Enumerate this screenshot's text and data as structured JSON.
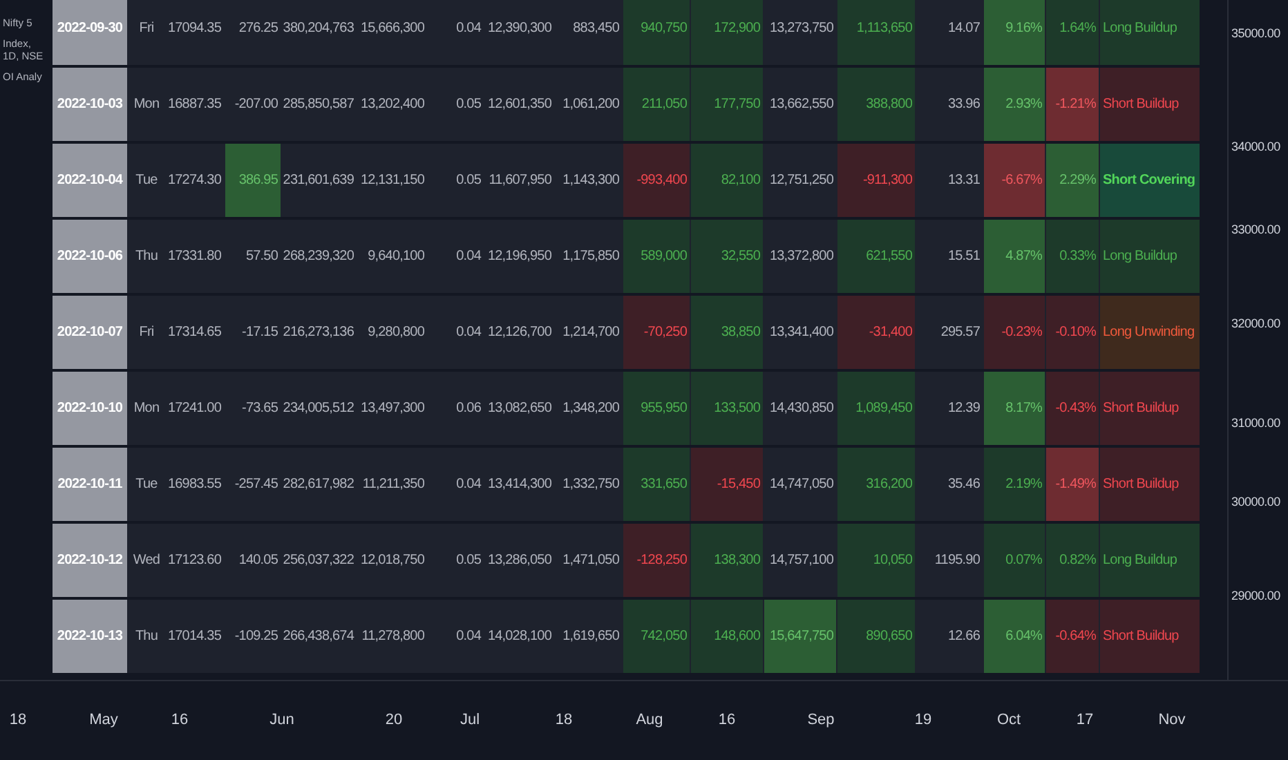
{
  "legend": [
    {
      "text": "Nifty 5"
    },
    {
      "text": "Index, 1D, NSE"
    },
    {
      "text": "OI Analy"
    }
  ],
  "table": {
    "rows": [
      {
        "date": "2022-09-30",
        "cells": [
          {
            "text": "Fri"
          },
          {
            "text": "17094.35"
          },
          {
            "text": "276.25"
          },
          {
            "text": "380,204,763"
          },
          {
            "text": "15,666,300"
          },
          {
            "text": "0.04"
          },
          {
            "text": "12,390,300"
          },
          {
            "text": "883,450"
          },
          {
            "text": "940,750",
            "color": "#1d3a2a"
          },
          {
            "text": "172,900",
            "color": "#1d3a2a"
          },
          {
            "text": "13,273,750"
          },
          {
            "text": "1,113,650",
            "color": "#1d3a2a"
          },
          {
            "text": "14.07"
          },
          {
            "text": "9.16%",
            "color": "#2c5e34"
          },
          {
            "text": "1.64%",
            "color": "#1d3a2a"
          },
          {
            "text": "Long Buildup",
            "color": "#1d3a2a"
          }
        ]
      },
      {
        "date": "2022-10-03",
        "cells": [
          {
            "text": "Mon"
          },
          {
            "text": "16887.35"
          },
          {
            "text": "-207.00"
          },
          {
            "text": "285,850,587"
          },
          {
            "text": "13,202,400"
          },
          {
            "text": "0.05"
          },
          {
            "text": "12,601,350"
          },
          {
            "text": "1,061,200"
          },
          {
            "text": "211,050",
            "color": "#1d3a2a"
          },
          {
            "text": "177,750",
            "color": "#1d3a2a"
          },
          {
            "text": "13,662,550"
          },
          {
            "text": "388,800",
            "color": "#1d3a2a"
          },
          {
            "text": "33.96"
          },
          {
            "text": "2.93%",
            "color": "#2c5e34"
          },
          {
            "text": "-1.21%",
            "color": "#6e2c31"
          },
          {
            "text": "Short Buildup",
            "color": "#3e1f26"
          }
        ]
      },
      {
        "date": "2022-10-04",
        "cells": [
          {
            "text": "Tue"
          },
          {
            "text": "17274.30"
          },
          {
            "text": "386.95",
            "color": "#2c5e34"
          },
          {
            "text": "231,601,639"
          },
          {
            "text": "12,131,150"
          },
          {
            "text": "0.05"
          },
          {
            "text": "11,607,950"
          },
          {
            "text": "1,143,300"
          },
          {
            "text": "-993,400",
            "color": "#3e1f26"
          },
          {
            "text": "82,100",
            "color": "#1d3a2a"
          },
          {
            "text": "12,751,250"
          },
          {
            "text": "-911,300",
            "color": "#3e1f26"
          },
          {
            "text": "13.31"
          },
          {
            "text": "-6.67%",
            "color": "#6e2c31"
          },
          {
            "text": "2.29%",
            "color": "#2c5e34"
          },
          {
            "text": "Short Covering",
            "color": "#184a3a"
          }
        ]
      },
      {
        "date": "2022-10-06",
        "cells": [
          {
            "text": "Thu"
          },
          {
            "text": "17331.80"
          },
          {
            "text": "57.50"
          },
          {
            "text": "268,239,320"
          },
          {
            "text": "9,640,100"
          },
          {
            "text": "0.04"
          },
          {
            "text": "12,196,950"
          },
          {
            "text": "1,175,850"
          },
          {
            "text": "589,000",
            "color": "#1d3a2a"
          },
          {
            "text": "32,550",
            "color": "#1d3a2a"
          },
          {
            "text": "13,372,800"
          },
          {
            "text": "621,550",
            "color": "#1d3a2a"
          },
          {
            "text": "15.51"
          },
          {
            "text": "4.87%",
            "color": "#2c5e34"
          },
          {
            "text": "0.33%",
            "color": "#1d3a2a"
          },
          {
            "text": "Long Buildup",
            "color": "#1d3a2a"
          }
        ]
      },
      {
        "date": "2022-10-07",
        "cells": [
          {
            "text": "Fri"
          },
          {
            "text": "17314.65"
          },
          {
            "text": "-17.15"
          },
          {
            "text": "216,273,136"
          },
          {
            "text": "9,280,800"
          },
          {
            "text": "0.04"
          },
          {
            "text": "12,126,700"
          },
          {
            "text": "1,214,700"
          },
          {
            "text": "-70,250",
            "color": "#3e1f26"
          },
          {
            "text": "38,850",
            "color": "#1d3a2a"
          },
          {
            "text": "13,341,400"
          },
          {
            "text": "-31,400",
            "color": "#3e1f26"
          },
          {
            "text": "295.57"
          },
          {
            "text": "-0.23%",
            "color": "#3e1f26"
          },
          {
            "text": "-0.10%",
            "color": "#3e1f26"
          },
          {
            "text": "Long Unwinding",
            "color": "#3f2a1d"
          }
        ]
      },
      {
        "date": "2022-10-10",
        "cells": [
          {
            "text": "Mon"
          },
          {
            "text": "17241.00"
          },
          {
            "text": "-73.65"
          },
          {
            "text": "234,005,512"
          },
          {
            "text": "13,497,300"
          },
          {
            "text": "0.06"
          },
          {
            "text": "13,082,650"
          },
          {
            "text": "1,348,200"
          },
          {
            "text": "955,950",
            "color": "#1d3a2a"
          },
          {
            "text": "133,500",
            "color": "#1d3a2a"
          },
          {
            "text": "14,430,850"
          },
          {
            "text": "1,089,450",
            "color": "#1d3a2a"
          },
          {
            "text": "12.39"
          },
          {
            "text": "8.17%",
            "color": "#2c5e34"
          },
          {
            "text": "-0.43%",
            "color": "#3e1f26"
          },
          {
            "text": "Short Buildup",
            "color": "#3e1f26"
          }
        ]
      },
      {
        "date": "2022-10-11",
        "cells": [
          {
            "text": "Tue"
          },
          {
            "text": "16983.55"
          },
          {
            "text": "-257.45"
          },
          {
            "text": "282,617,982"
          },
          {
            "text": "11,211,350"
          },
          {
            "text": "0.04"
          },
          {
            "text": "13,414,300"
          },
          {
            "text": "1,332,750"
          },
          {
            "text": "331,650",
            "color": "#1d3a2a"
          },
          {
            "text": "-15,450",
            "color": "#3e1f26"
          },
          {
            "text": "14,747,050"
          },
          {
            "text": "316,200",
            "color": "#1d3a2a"
          },
          {
            "text": "35.46"
          },
          {
            "text": "2.19%",
            "color": "#1d3a2a"
          },
          {
            "text": "-1.49%",
            "color": "#6e2c31"
          },
          {
            "text": "Short Buildup",
            "color": "#3e1f26"
          }
        ]
      },
      {
        "date": "2022-10-12",
        "cells": [
          {
            "text": "Wed"
          },
          {
            "text": "17123.60"
          },
          {
            "text": "140.05"
          },
          {
            "text": "256,037,322"
          },
          {
            "text": "12,018,750"
          },
          {
            "text": "0.05"
          },
          {
            "text": "13,286,050"
          },
          {
            "text": "1,471,050"
          },
          {
            "text": "-128,250",
            "color": "#3e1f26"
          },
          {
            "text": "138,300",
            "color": "#1d3a2a"
          },
          {
            "text": "14,757,100"
          },
          {
            "text": "10,050",
            "color": "#1d3a2a"
          },
          {
            "text": "1195.90"
          },
          {
            "text": "0.07%",
            "color": "#1d3a2a"
          },
          {
            "text": "0.82%",
            "color": "#1d3a2a"
          },
          {
            "text": "Long Buildup",
            "color": "#1d3a2a"
          }
        ]
      },
      {
        "date": "2022-10-13",
        "cells": [
          {
            "text": "Thu"
          },
          {
            "text": "17014.35"
          },
          {
            "text": "-109.25"
          },
          {
            "text": "266,438,674"
          },
          {
            "text": "11,278,800"
          },
          {
            "text": "0.04"
          },
          {
            "text": "14,028,100"
          },
          {
            "text": "1,619,650"
          },
          {
            "text": "742,050",
            "color": "#1d3a2a"
          },
          {
            "text": "148,600",
            "color": "#1d3a2a"
          },
          {
            "text": "15,647,750",
            "color": "#2c5e34"
          },
          {
            "text": "890,650",
            "color": "#1d3a2a"
          },
          {
            "text": "12.66"
          },
          {
            "text": "6.04%",
            "color": "#2c5e34"
          },
          {
            "text": "-0.64%",
            "color": "#3e1f26"
          },
          {
            "text": "Short Buildup",
            "color": "#3e1f26"
          }
        ]
      }
    ]
  },
  "price_axis": [
    "35000.00",
    "34000.00",
    "33000.00",
    "32000.00",
    "31000.00",
    "30000.00",
    "29000.00"
  ],
  "time_axis": [
    "18",
    "May",
    "16",
    "Jun",
    "20",
    "Jul",
    "18",
    "Aug",
    "16",
    "Sep",
    "19",
    "Oct",
    "17",
    "Nov"
  ]
}
